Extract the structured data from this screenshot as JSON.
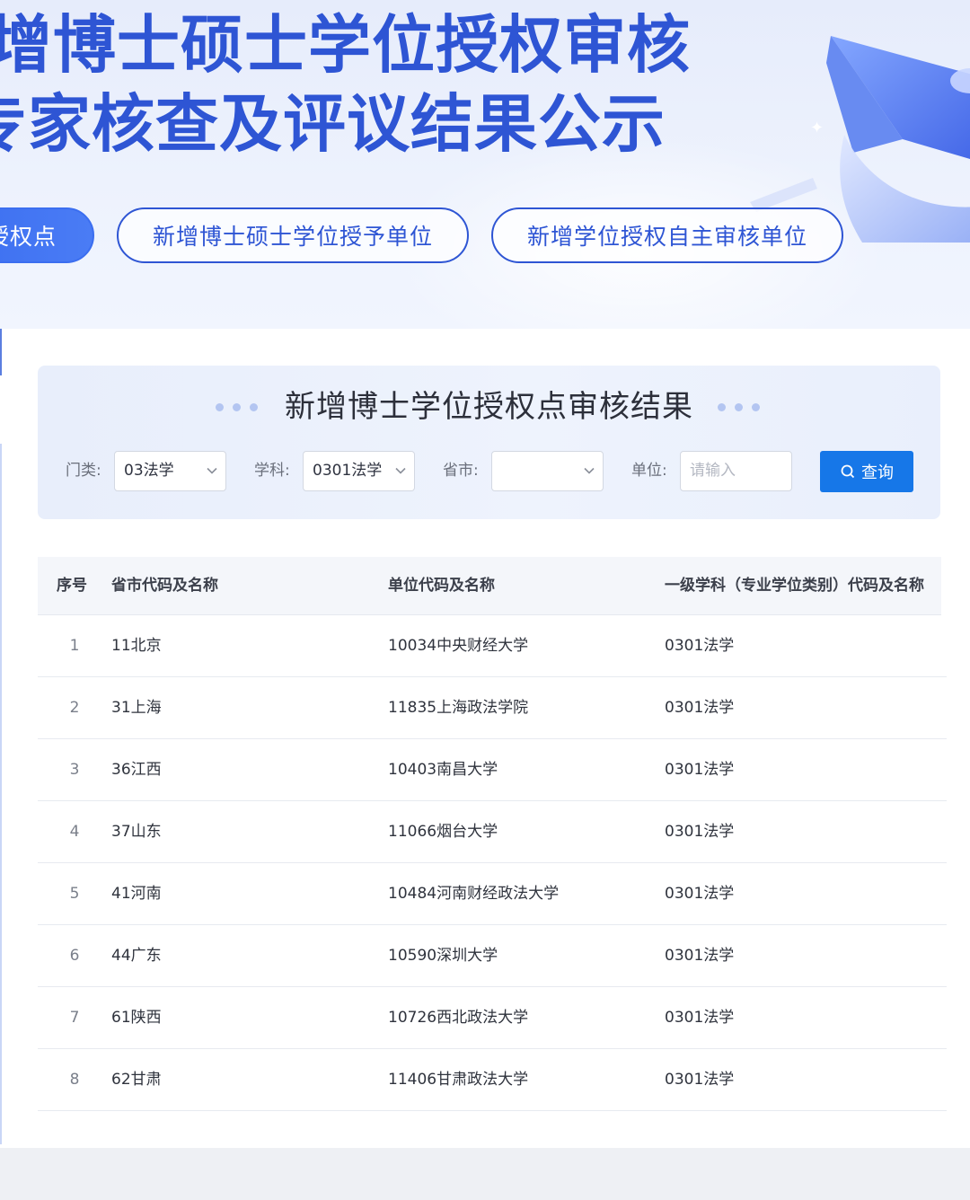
{
  "hero": {
    "title_line1": "增博士硕士学位授权审核",
    "title_line2": "专家核查及评议结果公示",
    "tabs": [
      {
        "label": "授权点"
      },
      {
        "label": "新增博士硕士学位授予单位"
      },
      {
        "label": "新增学位授权自主审核单位"
      }
    ]
  },
  "query": {
    "title": "新增博士学位授权点审核结果",
    "filters": {
      "category_label": "门类:",
      "category_value": "03法学",
      "subject_label": "学科:",
      "subject_value": "0301法学",
      "province_label": "省市:",
      "province_value": "",
      "unit_label": "单位:",
      "unit_placeholder": "请输入"
    },
    "search_button": "查询"
  },
  "table": {
    "headers": [
      "序号",
      "省市代码及名称",
      "单位代码及名称",
      "一级学科（专业学位类别）代码及名称"
    ],
    "rows": [
      {
        "no": "1",
        "province": "11北京",
        "unit": "10034中央财经大学",
        "subject": "0301法学"
      },
      {
        "no": "2",
        "province": "31上海",
        "unit": "11835上海政法学院",
        "subject": "0301法学"
      },
      {
        "no": "3",
        "province": "36江西",
        "unit": "10403南昌大学",
        "subject": "0301法学"
      },
      {
        "no": "4",
        "province": "37山东",
        "unit": "11066烟台大学",
        "subject": "0301法学"
      },
      {
        "no": "5",
        "province": "41河南",
        "unit": "10484河南财经政法大学",
        "subject": "0301法学"
      },
      {
        "no": "6",
        "province": "44广东",
        "unit": "10590深圳大学",
        "subject": "0301法学"
      },
      {
        "no": "7",
        "province": "61陕西",
        "unit": "10726西北政法大学",
        "subject": "0301法学"
      },
      {
        "no": "8",
        "province": "62甘肃",
        "unit": "11406甘肃政法大学",
        "subject": "0301法学"
      }
    ]
  },
  "colors": {
    "brand_blue": "#2e55d4",
    "button_blue": "#1677e8",
    "hero_bg": "#e6ecfb"
  },
  "icons": [
    "graduation-cap-illustration",
    "sparkle-icon",
    "chevron-down-icon",
    "search-icon"
  ]
}
